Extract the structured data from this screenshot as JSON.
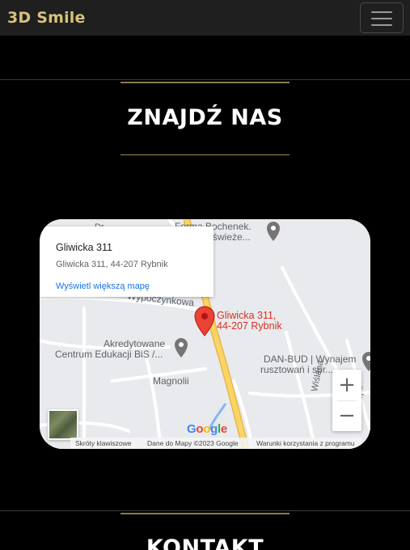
{
  "navbar": {
    "brand": "3D Smile",
    "toggle_icon": "hamburger-icon"
  },
  "find_us": {
    "title": "ZNAJDŹ NAS"
  },
  "map": {
    "place_name": "Gliwicka 311",
    "place_address": "Gliwicka 311, 44-207 Rybnik",
    "view_larger": "Wyświetl większą mapę",
    "pin_label_line1": "Gliwicka 311,",
    "pin_label_line2": "44-207 Rybnik",
    "labels": {
      "forma_line1": "Forma Bochenek.",
      "forma_line2": "świeże...",
      "wypoczynkowa": "Wypoczynkowa",
      "akredytowane_line1": "Akredytowane",
      "akredytowane_line2": "Centrum Edukacji BiS /...",
      "magnoli": "Magnolii",
      "danbud_line1": "DAN-BUD | Wynajem",
      "danbud_line2": "rusztowań i spr...",
      "wislana": "Wiślana",
      "partial_top": "Dr",
      "partial_right": "Bilsk..."
    },
    "zoom_in": "+",
    "zoom_out": "−",
    "google_logo": "Google",
    "footer": {
      "shortcuts": "Skróty klawiszowe",
      "map_data": "Dane do Mapy ©2023 Google",
      "terms": "Warunki korzystania z programu"
    }
  },
  "contact": {
    "title": "KONTAKT"
  }
}
